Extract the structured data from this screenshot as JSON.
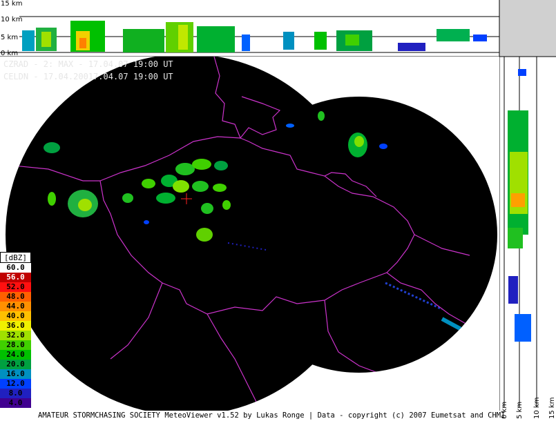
{
  "header": {
    "line1": "CZRAD - 2: MAX - 17.04.07 19:00 UT",
    "line2": "CELDN - 17.04.20017.04.07 19:00 UT"
  },
  "top_profile": {
    "labels": [
      "15 km",
      "10 km",
      "5 km",
      "0 km"
    ]
  },
  "side_profile": {
    "labels": [
      "0 km",
      "5 km",
      "10 km",
      "15 km"
    ]
  },
  "legend": {
    "title": "[dBZ]",
    "items": [
      {
        "value": "60.0",
        "color": "#ffffff",
        "text_color": "#000000"
      },
      {
        "value": "56.0",
        "color": "#c00000",
        "text_color": "#ffffff"
      },
      {
        "value": "52.0",
        "color": "#ff1010",
        "text_color": "#000000"
      },
      {
        "value": "48.0",
        "color": "#ff6000",
        "text_color": "#000000"
      },
      {
        "value": "44.0",
        "color": "#ff9000",
        "text_color": "#000000"
      },
      {
        "value": "40.0",
        "color": "#ffc000",
        "text_color": "#000000"
      },
      {
        "value": "36.0",
        "color": "#f0f000",
        "text_color": "#000000"
      },
      {
        "value": "32.0",
        "color": "#a0e000",
        "text_color": "#000000"
      },
      {
        "value": "28.0",
        "color": "#40d000",
        "text_color": "#000000"
      },
      {
        "value": "24.0",
        "color": "#00c000",
        "text_color": "#000000"
      },
      {
        "value": "20.0",
        "color": "#00a040",
        "text_color": "#000000"
      },
      {
        "value": "16.0",
        "color": "#0090c0",
        "text_color": "#000000"
      },
      {
        "value": "12.0",
        "color": "#0040ff",
        "text_color": "#000000"
      },
      {
        "value": "8.0",
        "color": "#2020c0",
        "text_color": "#000000"
      },
      {
        "value": "4.0",
        "color": "#400090",
        "text_color": "#000000"
      }
    ]
  },
  "footer": {
    "text": "AMATEUR STORMCHASING SOCIETY MeteoViewer v1.52 by Lukas Ronge | Data - copyright (c) 2007 Eumetsat and CHMI"
  }
}
